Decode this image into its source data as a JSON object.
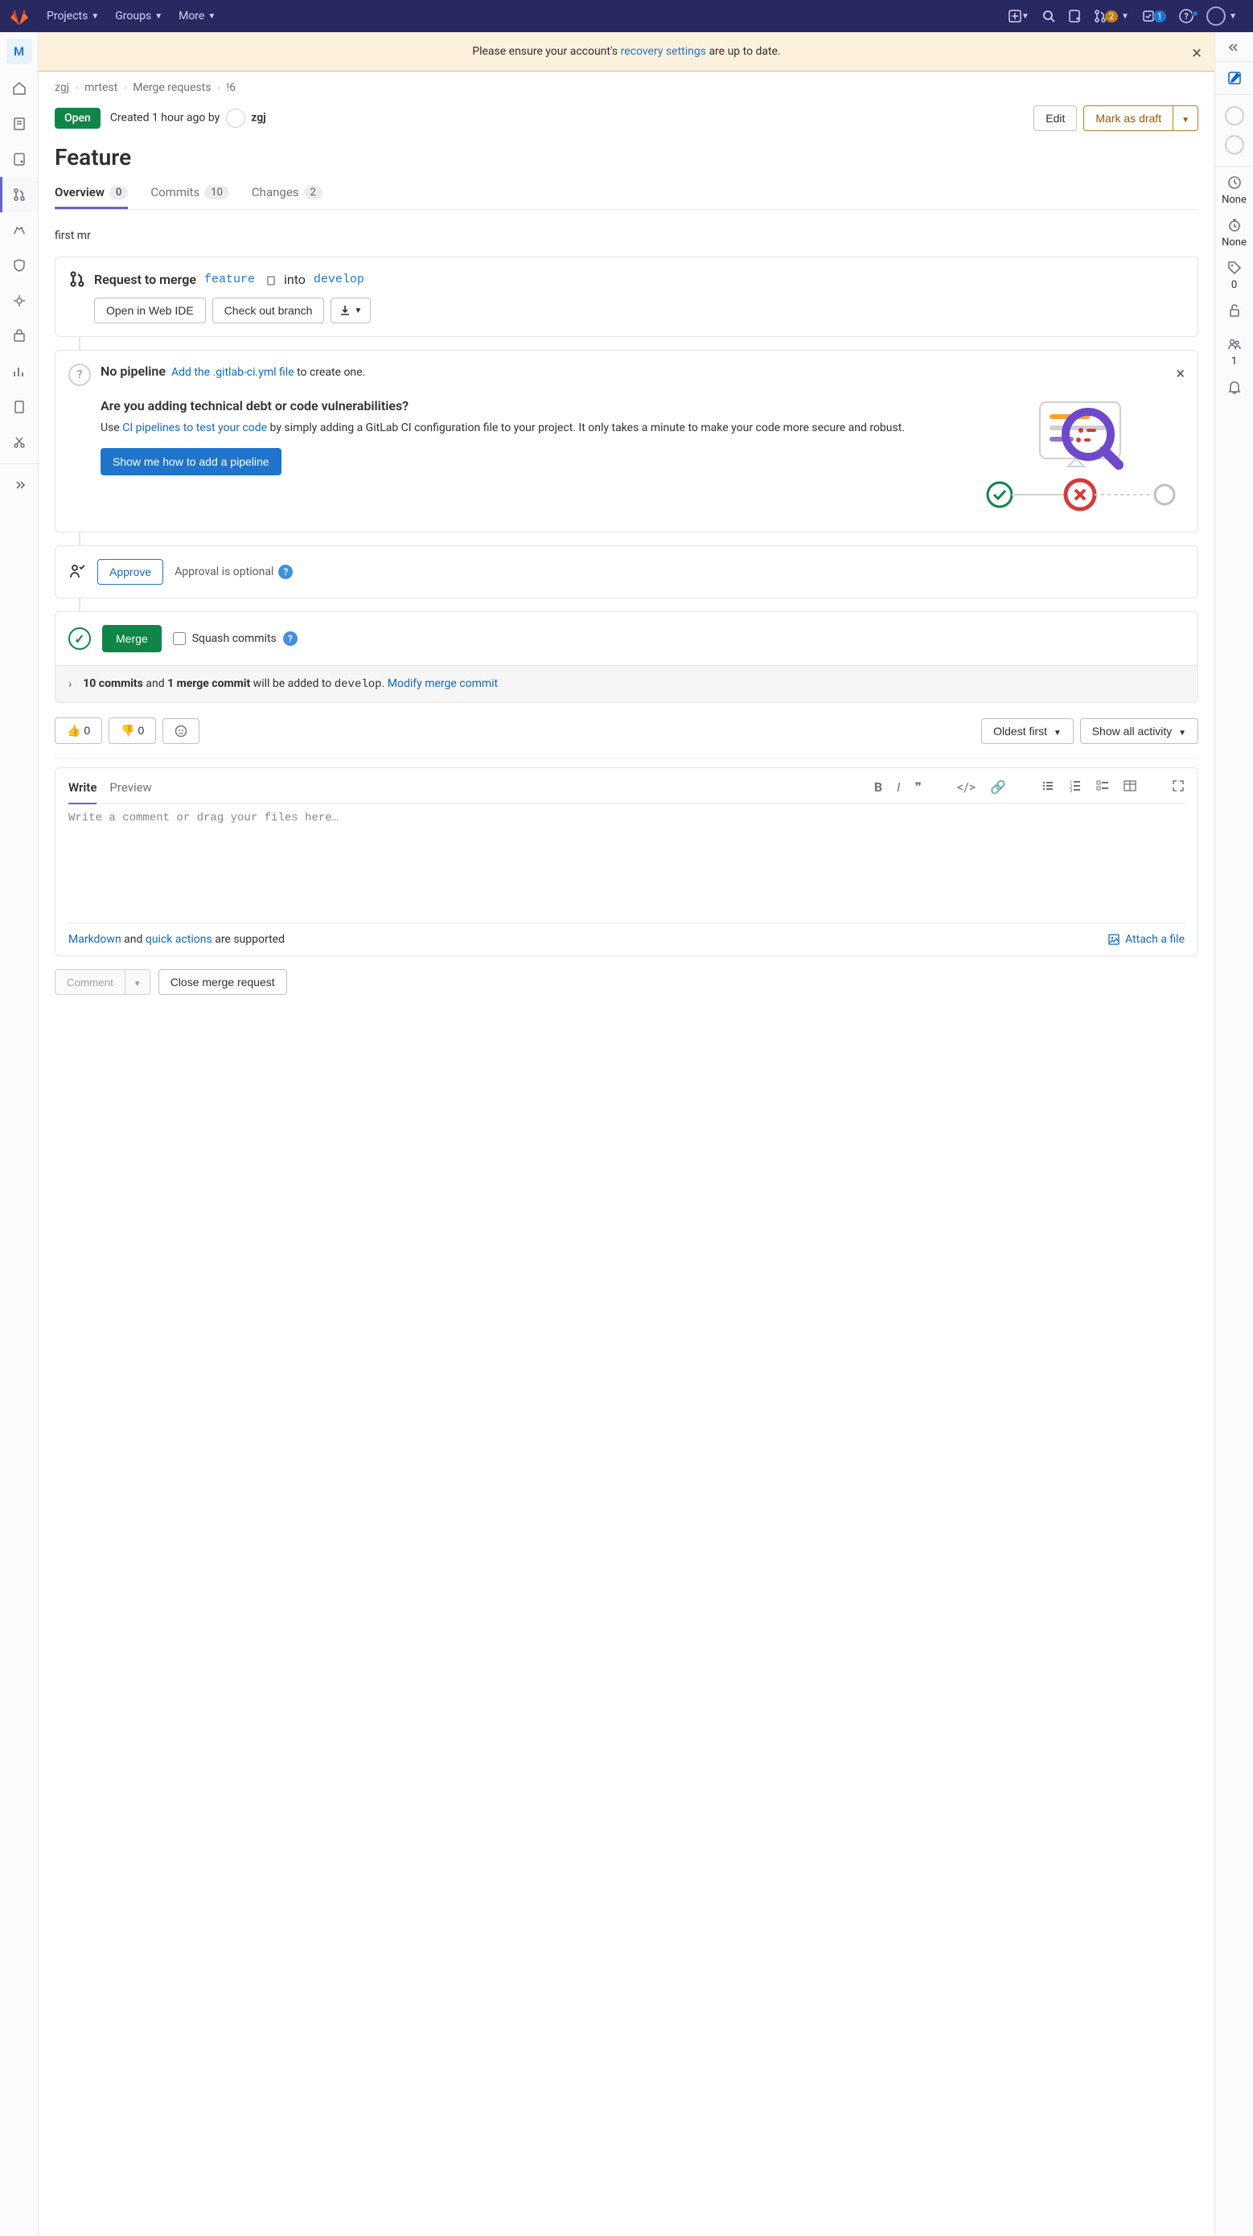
{
  "topbar": {
    "nav": {
      "projects": "Projects",
      "groups": "Groups",
      "more": "More"
    },
    "mr_badge": "2",
    "todo_badge": "1"
  },
  "sidebar_left": {
    "project_letter": "M"
  },
  "sidebar_right": {
    "milestone": "None",
    "time": "None",
    "labels": "0",
    "participants": "1"
  },
  "alert": {
    "pre": "Please ensure your account's ",
    "link": "recovery settings",
    "post": " are up to date."
  },
  "breadcrumbs": {
    "a": "zgj",
    "b": "mrtest",
    "c": "Merge requests",
    "d": "!6"
  },
  "header": {
    "status": "Open",
    "created": "Created 1 hour ago by",
    "author": "zgj",
    "edit": "Edit",
    "mark_draft": "Mark as draft"
  },
  "title": "Feature",
  "tabs": {
    "overview": "Overview",
    "overview_count": "0",
    "commits": "Commits",
    "commits_count": "10",
    "changes": "Changes",
    "changes_count": "2"
  },
  "description": "first mr",
  "merge_request": {
    "label": "Request to merge",
    "source": "feature",
    "into": "into",
    "target": "develop",
    "open_ide": "Open in Web IDE",
    "checkout": "Check out branch"
  },
  "pipeline": {
    "none": "No pipeline",
    "add_link": "Add the .gitlab-ci.yml file",
    "to_create": " to create one.",
    "heading": "Are you adding technical debt or code vulnerabilities?",
    "body_pre": "Use ",
    "body_link": "CI pipelines to test your code",
    "body_post": " by simply adding a GitLab CI configuration file to your project. It only takes a minute to make your code more secure and robust.",
    "cta": "Show me how to add a pipeline"
  },
  "approval": {
    "approve": "Approve",
    "optional": "Approval is optional"
  },
  "merge": {
    "btn": "Merge",
    "squash": "Squash commits",
    "footer_commits": "10 commits",
    "footer_and": " and ",
    "footer_merge_commit": "1 merge commit",
    "footer_added": " will be added to ",
    "footer_branch": "develop",
    "footer_link": "Modify merge commit"
  },
  "reactions": {
    "up": "0",
    "down": "0"
  },
  "filters": {
    "sort": "Oldest first",
    "activity": "Show all activity"
  },
  "comment": {
    "write": "Write",
    "preview": "Preview",
    "placeholder": "Write a comment or drag your files here…",
    "md": "Markdown",
    "and": " and ",
    "qa": "quick actions",
    "supported": " are supported",
    "attach": "Attach a file"
  },
  "actions": {
    "comment": "Comment",
    "close": "Close merge request"
  }
}
